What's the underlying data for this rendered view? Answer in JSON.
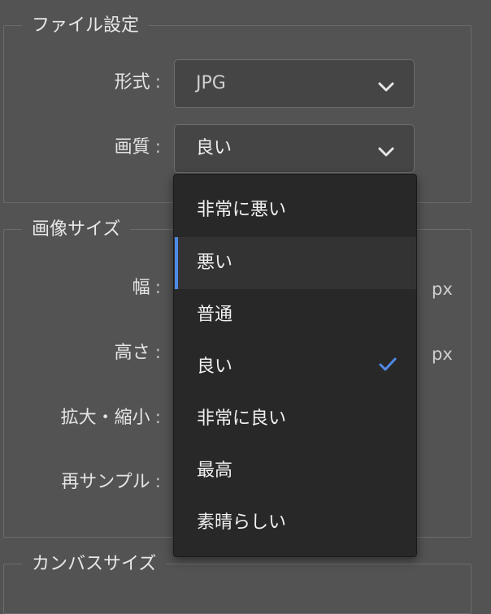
{
  "file_settings": {
    "title": "ファイル設定",
    "format_label": "形式",
    "format_value": "JPG",
    "quality_label": "画質",
    "quality_value": "良い"
  },
  "image_size": {
    "title": "画像サイズ",
    "width_label": "幅",
    "width_unit": "px",
    "height_label": "高さ",
    "height_unit": "px",
    "scale_label": "拡大・縮小",
    "resample_label": "再サンプル"
  },
  "canvas_size": {
    "title": "カンバスサイズ"
  },
  "label_colon": ":",
  "quality_menu": {
    "options": [
      "非常に悪い",
      "悪い",
      "普通",
      "良い",
      "非常に良い",
      "最高",
      "素晴らしい"
    ],
    "highlighted": "悪い",
    "selected": "良い",
    "accent_color": "#4e8ae6"
  },
  "icons": {
    "select_arrow": "chevron-down-icon",
    "selected_mark": "checkmark-icon"
  }
}
